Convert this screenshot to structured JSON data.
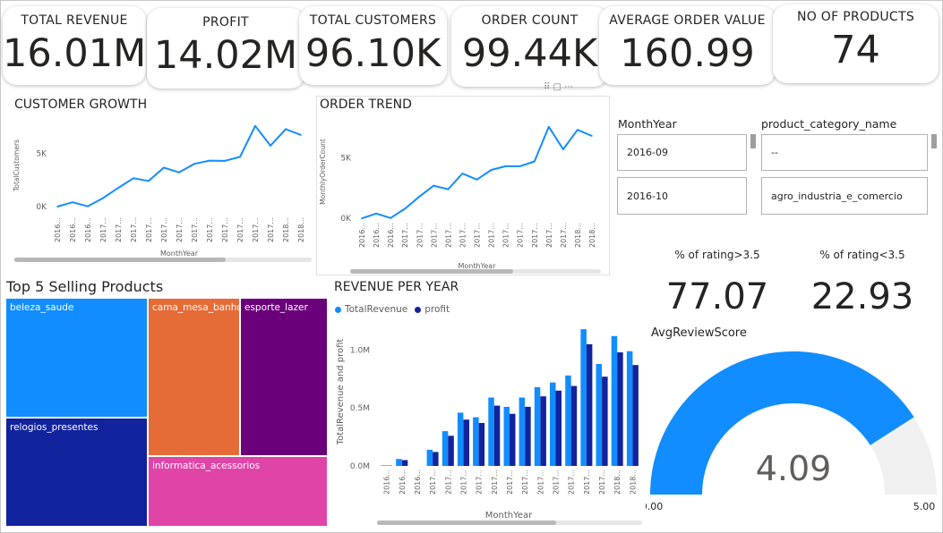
{
  "kpis": [
    {
      "label": "TOTAL REVENUE",
      "value": "16.01M"
    },
    {
      "label": "PROFIT",
      "value": "14.02M"
    },
    {
      "label": "TOTAL CUSTOMERS",
      "value": "96.10K"
    },
    {
      "label": "ORDER COUNT",
      "value": "99.44K"
    },
    {
      "label": "AVERAGE ORDER VALUE",
      "value": "160.99"
    },
    {
      "label": "NO OF PRODUCTS",
      "value": "74"
    }
  ],
  "slicers": {
    "month_header": "MonthYear",
    "month_items": [
      "2016-09",
      "2016-10"
    ],
    "category_header": "product_category_name",
    "category_items": [
      "--",
      "agro_industria_e_comercio"
    ]
  },
  "ratings": {
    "above_label": "% of rating>3.5",
    "above_value": "77.07",
    "below_label": "% of rating<3.5",
    "below_value": "22.93"
  },
  "colors": {
    "line": "#118DFF",
    "revenue": "#118DFF",
    "profit": "#12239E",
    "gauge_fill": "#118DFF",
    "gauge_bg": "#F0F0F0"
  },
  "chart_data": [
    {
      "type": "line",
      "title": "CUSTOMER GROWTH",
      "xlabel": "MonthYear",
      "ylabel": "TotalCustomers",
      "yticks": [
        "0K",
        "5K"
      ],
      "ytick_values": [
        0,
        5000
      ],
      "ylim": [
        -500,
        8200
      ],
      "categories": [
        "2016...",
        "2016...",
        "2016...",
        "2017...",
        "2017...",
        "2017...",
        "2017...",
        "2017...",
        "2017...",
        "2017...",
        "2017...",
        "2017...",
        "2017...",
        "2017...",
        "2017...",
        "2018...",
        "2018..."
      ],
      "values": [
        0,
        400,
        30,
        800,
        1750,
        2650,
        2400,
        3650,
        3200,
        4000,
        4300,
        4280,
        4650,
        7550,
        5700,
        7250,
        6700
      ],
      "grid": false
    },
    {
      "type": "line",
      "title": "ORDER TREND",
      "xlabel": "MonthYear",
      "ylabel": "MonthlyOrderCount",
      "yticks": [
        "0K",
        "5K"
      ],
      "ytick_values": [
        0,
        5000
      ],
      "ylim": [
        -500,
        8200
      ],
      "categories": [
        "2016...",
        "2016...",
        "2016...",
        "2017...",
        "2017...",
        "2017...",
        "2017...",
        "2017...",
        "2017...",
        "2017...",
        "2017...",
        "2017...",
        "2017...",
        "2017...",
        "2017...",
        "2018...",
        "2018..."
      ],
      "values": [
        0,
        400,
        30,
        800,
        1800,
        2700,
        2400,
        3700,
        3200,
        4000,
        4300,
        4300,
        4700,
        7550,
        5700,
        7300,
        6800
      ],
      "grid": false
    },
    {
      "type": "bar",
      "title": "REVENUE PER YEAR",
      "xlabel": "MonthYear",
      "ylabel": "TotalRevenue and profit",
      "yticks": [
        "0.0M",
        "0.5M",
        "1.0M"
      ],
      "ytick_values": [
        0,
        500000,
        1000000
      ],
      "ylim": [
        0,
        1250000
      ],
      "categories": [
        "2016...",
        "2016...",
        "2016...",
        "2017...",
        "2017...",
        "2017...",
        "2017...",
        "2017...",
        "2017...",
        "2017...",
        "2017...",
        "2017...",
        "2017...",
        "2017...",
        "2017...",
        "2018...",
        "2018..."
      ],
      "series": [
        {
          "name": "TotalRevenue",
          "values": [
            5000,
            60000,
            0,
            140000,
            300000,
            460000,
            420000,
            590000,
            510000,
            590000,
            680000,
            720000,
            780000,
            1180000,
            880000,
            1120000,
            990000
          ]
        },
        {
          "name": "profit",
          "values": [
            3000,
            50000,
            0,
            120000,
            260000,
            400000,
            370000,
            520000,
            450000,
            510000,
            600000,
            650000,
            690000,
            1050000,
            770000,
            980000,
            870000
          ]
        }
      ],
      "legend": "top-left",
      "grid": false
    },
    {
      "type": "treemap",
      "title": "Top 5 Selling Products",
      "items": [
        {
          "name": "beleza_saude"
        },
        {
          "name": "relogios_presentes"
        },
        {
          "name": "cama_mesa_banho"
        },
        {
          "name": "informatica_acessorios"
        },
        {
          "name": "esporte_lazer"
        }
      ],
      "colors": [
        "#118DFF",
        "#12239E",
        "#E66C37",
        "#E044A7",
        "#6B007B"
      ]
    },
    {
      "type": "gauge",
      "title": "AvgReviewScore",
      "value": 4.09,
      "value_label": "4.09",
      "min": 0,
      "max": 5,
      "min_label": "0.00",
      "max_label": "5.00"
    }
  ]
}
